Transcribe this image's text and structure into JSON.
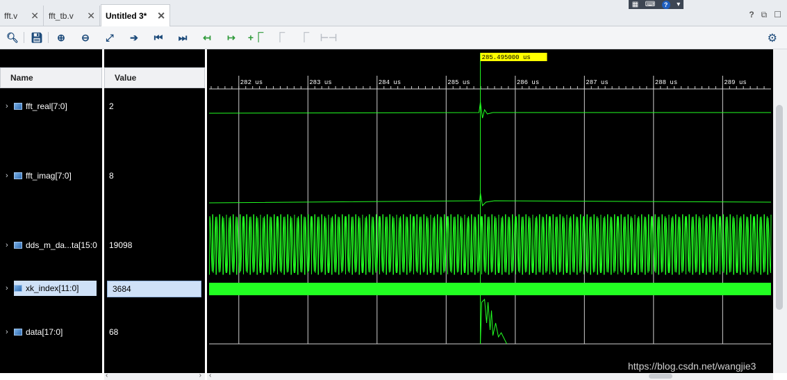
{
  "tabs": [
    {
      "label": "fft.v",
      "active": false
    },
    {
      "label": "fft_tb.v",
      "active": false
    },
    {
      "label": "Untitled 3*",
      "active": true
    }
  ],
  "tab_close_glyph": "✕",
  "window_controls": {
    "help": "?",
    "restore": "⧉",
    "maximize": "☐"
  },
  "toolbar": {
    "buttons": [
      {
        "name": "search-icon",
        "glyph": "🔍︎",
        "enabled": true
      },
      {
        "name": "save-icon",
        "glyph": "💾︎",
        "enabled": true
      },
      {
        "name": "zoom-in-icon",
        "glyph": "⊕",
        "enabled": true
      },
      {
        "name": "zoom-out-icon",
        "glyph": "⊖",
        "enabled": true
      },
      {
        "name": "zoom-fit-icon",
        "glyph": "⤢",
        "enabled": true
      },
      {
        "name": "go-to-cursor-icon",
        "glyph": "➔",
        "enabled": true
      },
      {
        "name": "go-to-time-0-icon",
        "glyph": "⏮",
        "enabled": true
      },
      {
        "name": "go-to-last-time-icon",
        "glyph": "⏭",
        "enabled": true
      },
      {
        "name": "previous-transition-icon",
        "glyph": "↤",
        "enabled": true
      },
      {
        "name": "next-transition-icon",
        "glyph": "↦",
        "enabled": true
      },
      {
        "name": "add-marker-icon",
        "glyph": "+⎾",
        "enabled": true
      },
      {
        "name": "previous-marker-icon",
        "glyph": "⎾",
        "enabled": false
      },
      {
        "name": "next-marker-icon",
        "glyph": "⎾",
        "enabled": false
      },
      {
        "name": "swap-cursors-icon",
        "glyph": "⊢⊣",
        "enabled": false
      }
    ]
  },
  "columns": {
    "name": "Name",
    "value": "Value"
  },
  "signals": [
    {
      "name": "fft_real[7:0]",
      "value": "2",
      "selected": false
    },
    {
      "name": "fft_imag[7:0]",
      "value": "8",
      "selected": false
    },
    {
      "name": "dds_m_da...ta[15:0",
      "value": "19098",
      "selected": false
    },
    {
      "name": "xk_index[11:0]",
      "value": "3684",
      "selected": true
    },
    {
      "name": "data[17:0]",
      "value": "68",
      "selected": false
    }
  ],
  "cursor": {
    "label": "285.495000 us",
    "time_us": 285.495
  },
  "time_axis": {
    "ticks": [
      "282 us",
      "283 us",
      "284 us",
      "285 us",
      "286 us",
      "287 us",
      "288 us",
      "289 us"
    ],
    "start_us": 281.57,
    "end_us": 289.7
  },
  "colors": {
    "wave": "#22ff22",
    "cursor_label_bg": "#ffff00",
    "grid": "#d0d0d0",
    "selected": "#cfe1f7"
  },
  "scroll_arrows": {
    "left": "‹",
    "right": "›"
  },
  "watermark": "https://blog.csdn.net/wangjie3"
}
